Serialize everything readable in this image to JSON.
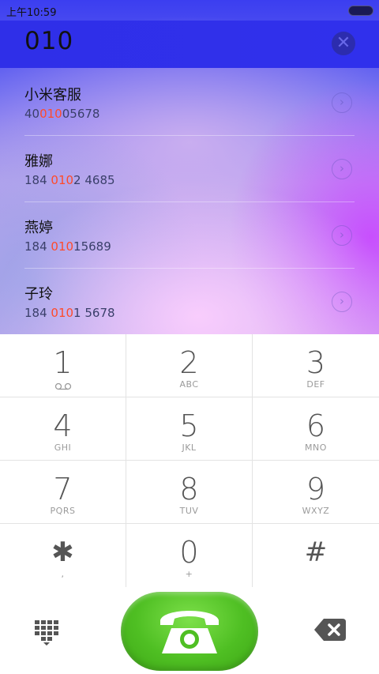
{
  "status_bar": {
    "time": "上午10:59"
  },
  "search": {
    "query": "010"
  },
  "results": [
    {
      "name": "小米客服",
      "number_pre": "40",
      "number_match": "010",
      "number_post": "05678"
    },
    {
      "name": "雅娜",
      "number_pre": "184 ",
      "number_match": "010",
      "number_post": "2 4685"
    },
    {
      "name": "燕婷",
      "number_pre": "184 ",
      "number_match": "010",
      "number_post": "15689"
    },
    {
      "name": "子玲",
      "number_pre": "184 ",
      "number_match": "010",
      "number_post": "1 5678"
    }
  ],
  "keypad": {
    "k1": {
      "digit": "1",
      "letters": ""
    },
    "k2": {
      "digit": "2",
      "letters": "ABC"
    },
    "k3": {
      "digit": "3",
      "letters": "DEF"
    },
    "k4": {
      "digit": "4",
      "letters": "GHI"
    },
    "k5": {
      "digit": "5",
      "letters": "JKL"
    },
    "k6": {
      "digit": "6",
      "letters": "MNO"
    },
    "k7": {
      "digit": "7",
      "letters": "PQRS"
    },
    "k8": {
      "digit": "8",
      "letters": "TUV"
    },
    "k9": {
      "digit": "9",
      "letters": "WXYZ"
    },
    "kstar": {
      "digit": "✱",
      "letters": ","
    },
    "k0": {
      "digit": "0",
      "letters": "+"
    },
    "khash": {
      "digit": "#",
      "letters": ""
    }
  },
  "icons": {
    "clear": "close-circle-icon",
    "chevron": "chevron-right-icon",
    "voicemail": "voicemail-icon",
    "dialpad": "dialpad-grid-icon",
    "call": "telephone-icon",
    "backspace": "backspace-icon"
  },
  "colors": {
    "accent_blue": "#3030ec",
    "match_highlight": "#ff4a2a",
    "call_green": "#4fbf23"
  }
}
